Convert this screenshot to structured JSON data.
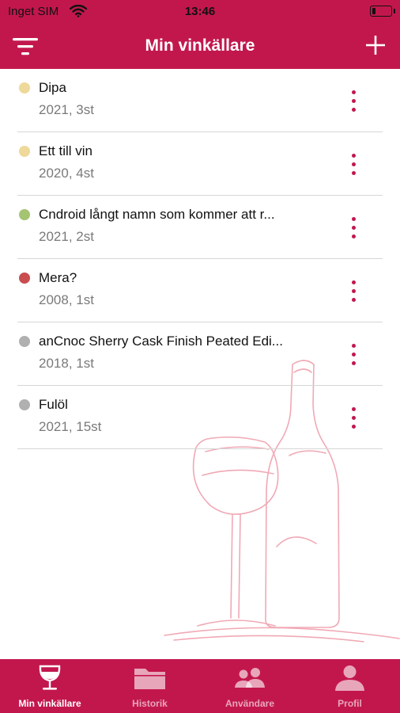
{
  "status_bar": {
    "carrier": "Inget SIM",
    "time": "13:46"
  },
  "header": {
    "title": "Min vinkällare"
  },
  "wines": [
    {
      "name": "Dipa",
      "meta": "2021, 3st",
      "dot_color": "#eed99a"
    },
    {
      "name": "Ett till vin",
      "meta": "2020, 4st",
      "dot_color": "#eed99a"
    },
    {
      "name": "Cndroid långt namn som kommer att r...",
      "meta": "2021, 2st",
      "dot_color": "#a5c472"
    },
    {
      "name": "Mera?",
      "meta": "2008, 1st",
      "dot_color": "#c94d4f"
    },
    {
      "name": "anCnoc Sherry Cask Finish Peated Edi...",
      "meta": "2018, 1st",
      "dot_color": "#b0b0b0"
    },
    {
      "name": "Fulöl",
      "meta": "2021, 15st",
      "dot_color": "#b0b0b0"
    }
  ],
  "tabs": [
    {
      "label": "Min vinkällare",
      "icon": "wine-glass-icon",
      "active": true
    },
    {
      "label": "Historik",
      "icon": "folder-icon",
      "active": false
    },
    {
      "label": "Användare",
      "icon": "users-icon",
      "active": false
    },
    {
      "label": "Profil",
      "icon": "profile-icon",
      "active": false
    }
  ],
  "colors": {
    "accent": "#c2174d",
    "illustration": "#f0a9b5"
  }
}
